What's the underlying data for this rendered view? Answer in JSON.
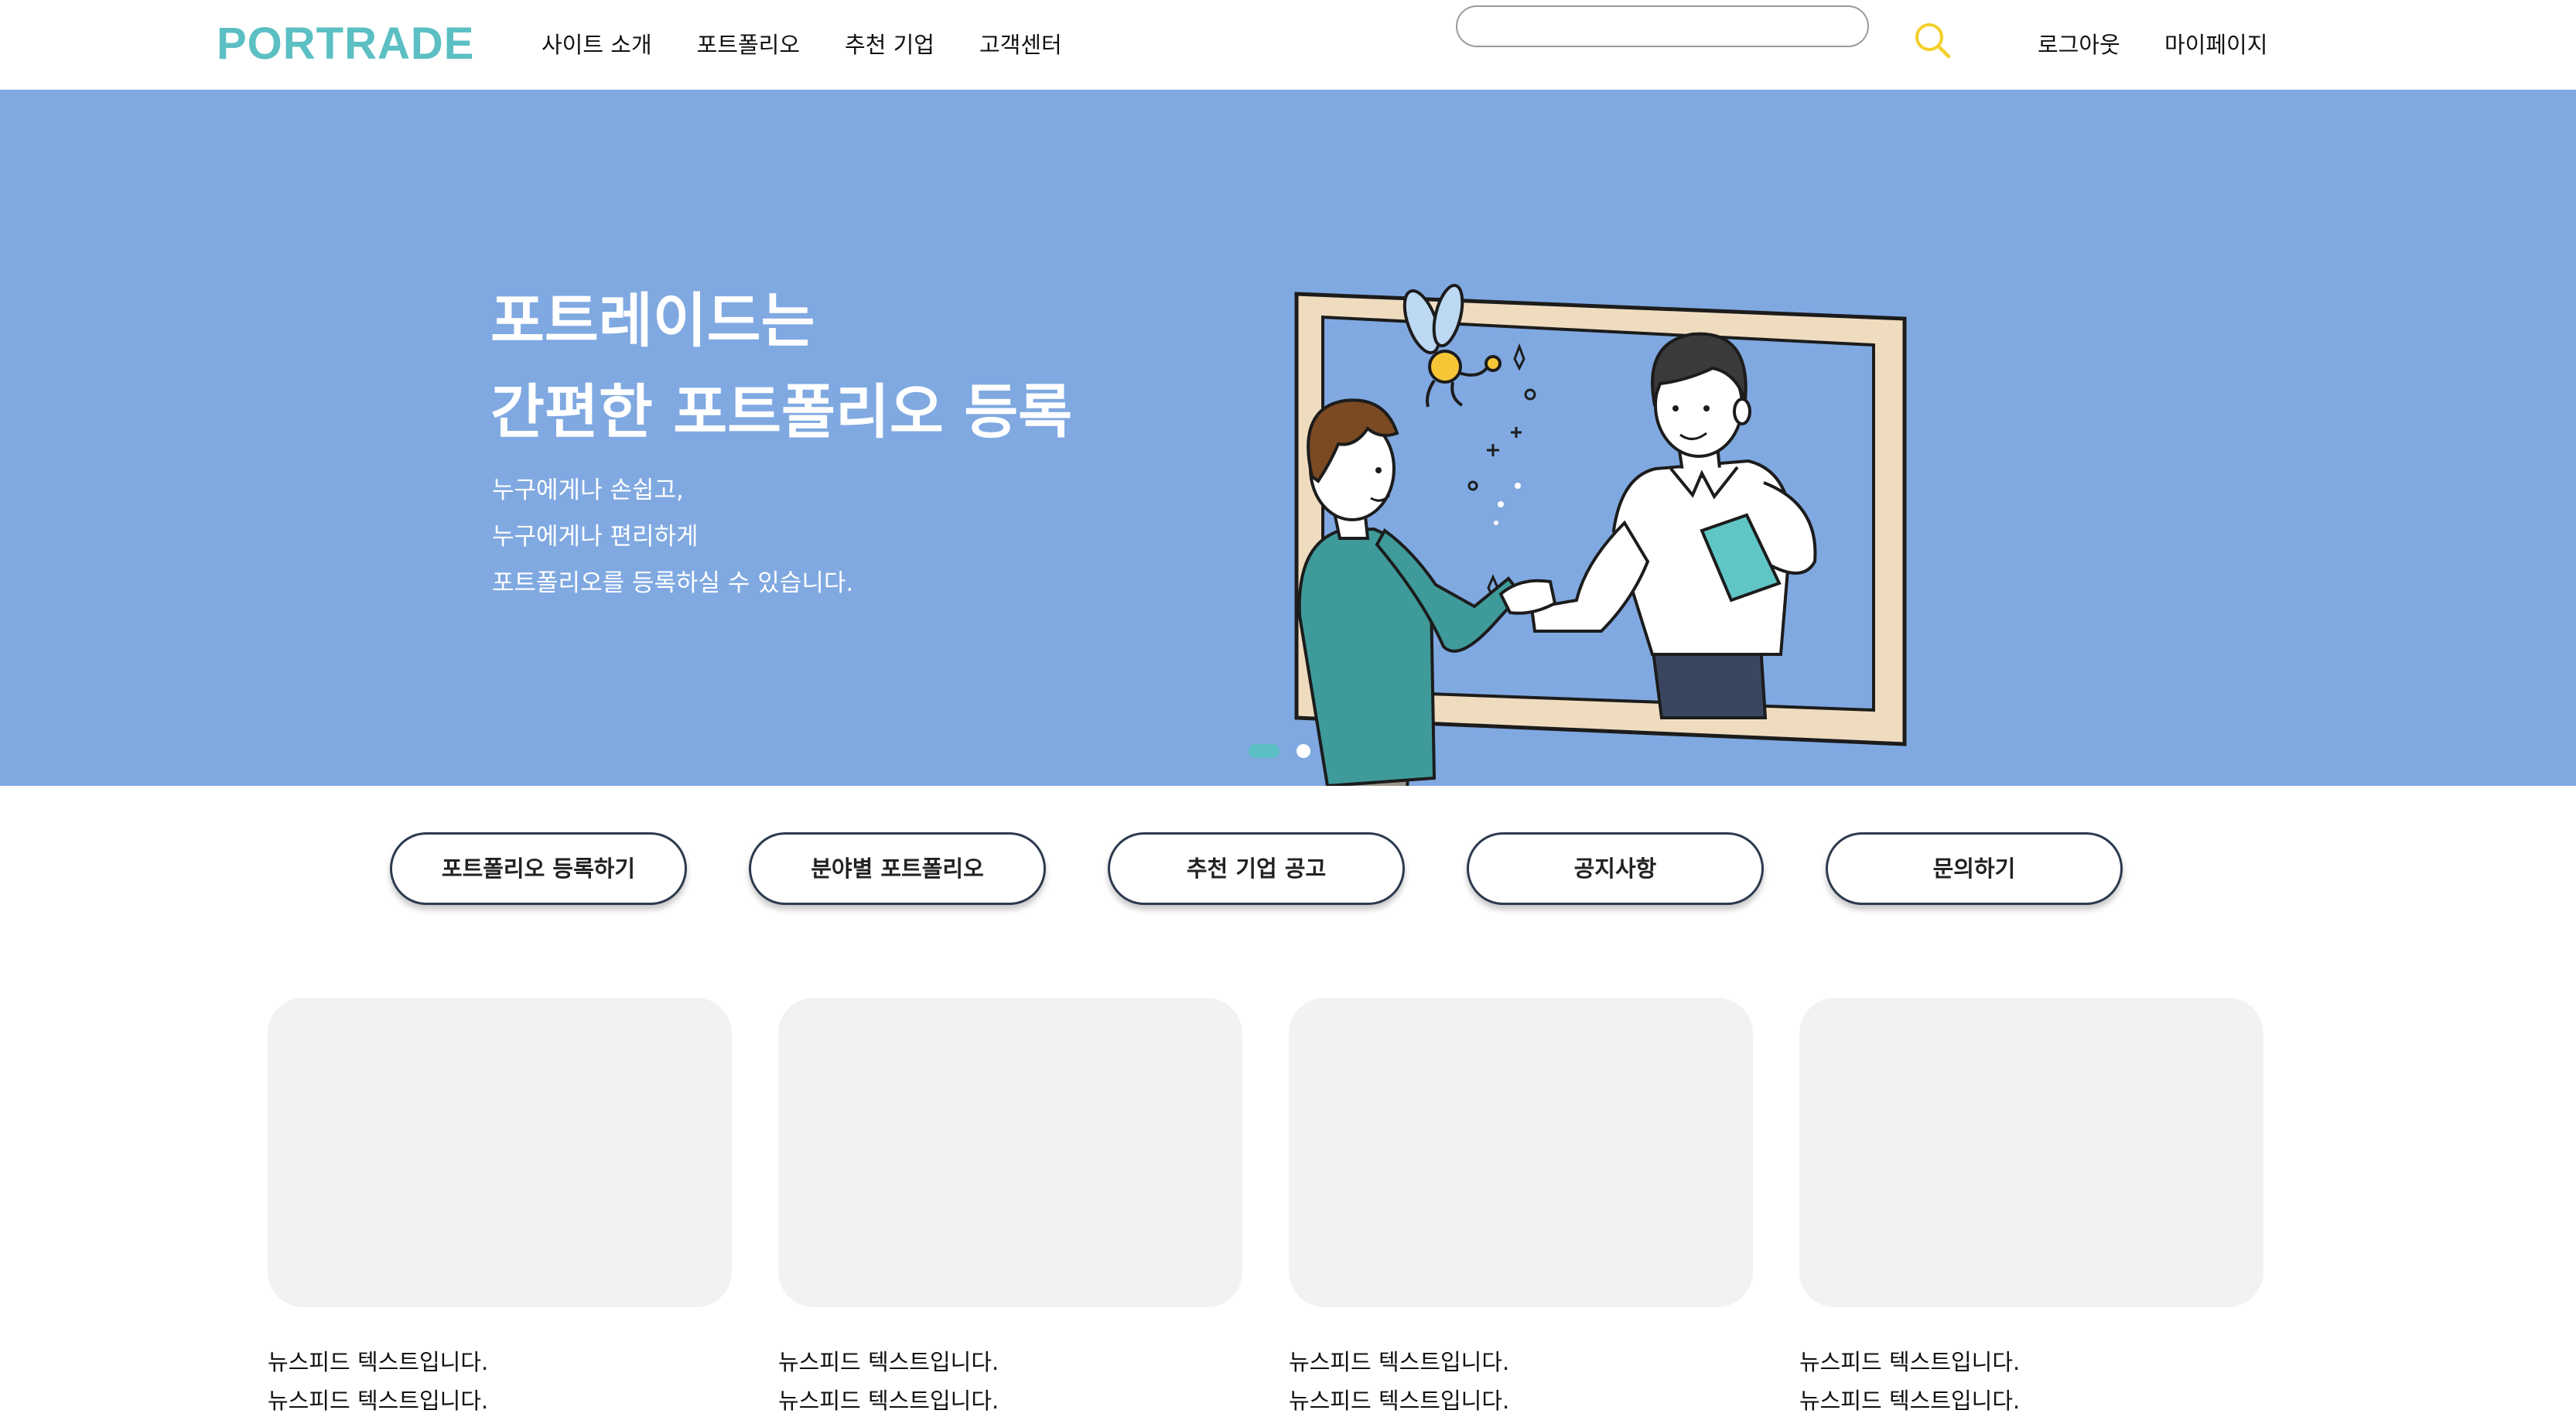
{
  "header": {
    "logo": "PORTRADE",
    "nav": [
      {
        "label": "사이트 소개"
      },
      {
        "label": "포트폴리오"
      },
      {
        "label": "추천 기업"
      },
      {
        "label": "고객센터"
      }
    ],
    "search": {
      "value": "",
      "placeholder": ""
    },
    "logout_label": "로그아웃",
    "mypage_label": "마이페이지"
  },
  "hero": {
    "title_line1": "포트레이드는",
    "title_line2": "간편한 포트폴리오 등록",
    "desc_line1": "누구에게나 손쉽고,",
    "desc_line2": "누구에게나 편리하게",
    "desc_line3": "포트폴리오를 등록하실 수 있습니다.",
    "background_color": "#80a9e1",
    "active_slide": 1,
    "slide_count": 2
  },
  "quick_links": [
    {
      "label": "포트폴리오 등록하기"
    },
    {
      "label": "분야별 포트폴리오"
    },
    {
      "label": "추천 기업 공고"
    },
    {
      "label": "공지사항"
    },
    {
      "label": "문의하기"
    }
  ],
  "cards": [
    {
      "line1": "뉴스피드 텍스트입니다.",
      "line2": "뉴스피드 텍스트입니다."
    },
    {
      "line1": "뉴스피드 텍스트입니다.",
      "line2": "뉴스피드 텍스트입니다."
    },
    {
      "line1": "뉴스피드 텍스트입니다.",
      "line2": "뉴스피드 텍스트입니다."
    },
    {
      "line1": "뉴스피드 텍스트입니다.",
      "line2": "뉴스피드 텍스트입니다."
    }
  ],
  "colors": {
    "brand": "#5bbfc3",
    "search_icon": "#f5cf2a",
    "hero_bg": "#80a9e1",
    "button_border": "#2c3a4e",
    "card_bg": "#f2f2f2"
  },
  "icons": {
    "search": "search-icon",
    "illustration": "handshake-through-frame-illustration"
  }
}
